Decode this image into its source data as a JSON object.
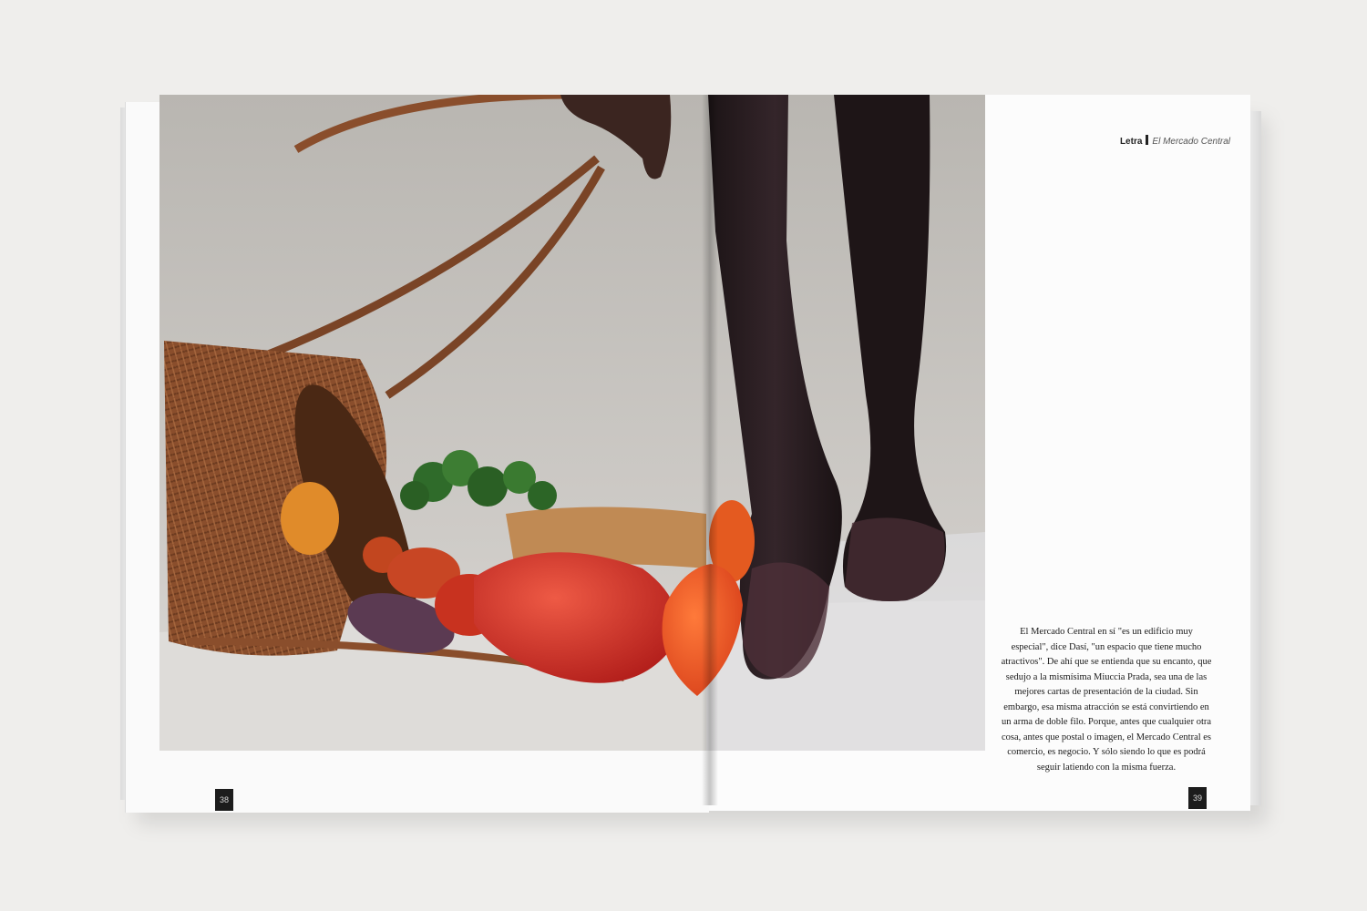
{
  "header": {
    "section": "Letra",
    "article": "El Mercado Central"
  },
  "body_text": "El Mercado Central en sí \"es un edificio muy especial\", dice Dasí, \"un espacio que tiene mucho atractivos\". De ahí que se entienda que su encanto, que sedujo a la mismísima Miuccia Prada, sea una de las mejores cartas de presentación de la ciudad. Sin embargo, esa misma atracción se está convirtiendo en un arma de doble filo. Porque, antes que cualquier otra cosa, antes que postal o imagen, el Mercado Central es comercio, es negocio. Y sólo siendo lo que es podrá seguir latiendo con la misma fuerza.",
  "page_numbers": {
    "left": "38",
    "right": "39"
  },
  "photo": {
    "subject": "wicker basket spilling vegetables beside bare feet",
    "colors": {
      "background": "#c9c6c1",
      "floor": "#dedcd9",
      "basket": "#8a4e2c",
      "pepper": "#d2302a",
      "tomato": "#e6501f",
      "skin": "#2a1c1e"
    }
  }
}
